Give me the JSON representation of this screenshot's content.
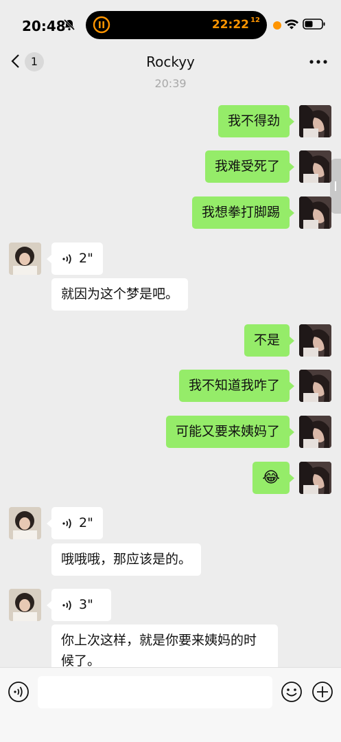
{
  "status_bar": {
    "time": "20:48",
    "island_clock": "22:22",
    "island_clock_sup": "12"
  },
  "nav": {
    "unread_count": "1",
    "title": "Rockyy"
  },
  "chat": {
    "timestamp": "20:39",
    "messages": [
      {
        "from": "me",
        "text": "我不得劲"
      },
      {
        "from": "me",
        "text": "我难受死了"
      },
      {
        "from": "me",
        "text": "我想拳打脚踢"
      },
      {
        "from": "other",
        "type": "voice",
        "duration": "2\""
      },
      {
        "from": "other",
        "text": "就因为这个梦是吧。"
      },
      {
        "from": "me",
        "text": "不是"
      },
      {
        "from": "me",
        "text": "我不知道我咋了"
      },
      {
        "from": "me",
        "text": "可能又要来姨妈了"
      },
      {
        "from": "me",
        "type": "emoji",
        "text": "😂"
      },
      {
        "from": "other",
        "type": "voice",
        "duration": "2\""
      },
      {
        "from": "other",
        "text": "哦哦哦，那应该是的。"
      },
      {
        "from": "other",
        "type": "voice",
        "duration": "3\""
      },
      {
        "from": "other",
        "text": "你上次这样，就是你要来姨妈的时候了。"
      }
    ]
  },
  "input_bar": {
    "voice_icon": "voice-icon",
    "emoji_icon": "emoji-icon",
    "plus_icon": "plus-icon"
  }
}
